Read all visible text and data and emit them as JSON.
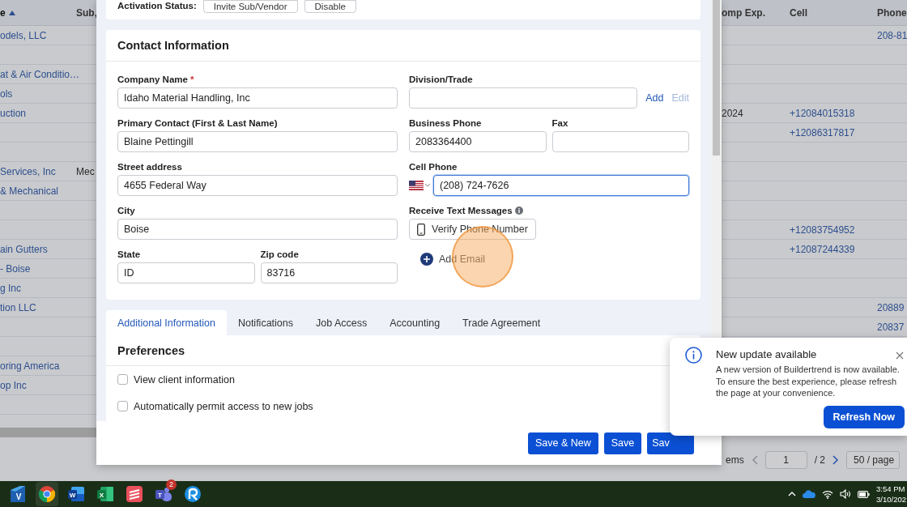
{
  "background_table": {
    "columns": [
      {
        "label": "e",
        "sorted": true
      },
      {
        "label": "Sub,",
        "sorted": false
      },
      {
        "label": "omp Exp.",
        "sorted": false
      },
      {
        "label": "Cell",
        "sorted": false
      },
      {
        "label": "Phone",
        "sorted": false
      }
    ],
    "rows": [
      {
        "name": "odels, LLC",
        "phone": "208-81"
      },
      {},
      {
        "name": "at & Air Conditio…"
      },
      {
        "name": "ols"
      },
      {
        "name": "uction",
        "comp_exp": "2024",
        "cell": "+12084015318"
      },
      {
        "cell": "+12086317817"
      },
      {},
      {
        "name": "Services, Inc",
        "sub": "Mec"
      },
      {
        "name": "& Mechanical"
      },
      {},
      {
        "cell": "+12083754952"
      },
      {
        "name": "ain Gutters",
        "cell": "+12087244339"
      },
      {
        "name": "- Boise"
      },
      {
        "name": "g Inc"
      },
      {
        "name": "tion LLC",
        "phone": "20889"
      },
      {
        "phone": "20837"
      },
      {},
      {
        "name": "oring America"
      },
      {
        "name": "op Inc"
      },
      {}
    ],
    "pagination": {
      "summary": "ems",
      "page": "1",
      "total": "/ 2",
      "page_size": "50 / page"
    }
  },
  "modal": {
    "activation": {
      "label": "Activation Status:",
      "buttons": [
        "Invite Sub/Vendor",
        "Disable"
      ]
    },
    "contact": {
      "title": "Contact Information",
      "rows": [
        {
          "left": [
            {
              "kind": "input",
              "label": "Company Name",
              "required_mark": "*",
              "value": "Idaho Material Handling, Inc"
            }
          ],
          "right": [
            {
              "kind": "input_links",
              "label": "Division/Trade",
              "links": [
                {
                  "label": "Add",
                  "disabled": false
                },
                {
                  "label": "Edit",
                  "disabled": true
                }
              ]
            }
          ]
        },
        {
          "left": [
            {
              "kind": "input",
              "label": "Primary Contact (First & Last Name)",
              "value": "Blaine Pettingill"
            }
          ],
          "right": [
            {
              "kind": "input",
              "label": "Business Phone",
              "value": "2083364400"
            },
            {
              "kind": "input",
              "label": "Fax"
            }
          ]
        },
        {
          "left": [
            {
              "kind": "input",
              "label": "Street address",
              "value": "4655 Federal Way"
            }
          ],
          "right": [
            {
              "kind": "phone",
              "label": "Cell Phone",
              "value": "(208) 724-7626",
              "focused": true
            }
          ]
        },
        {
          "left": [
            {
              "kind": "input",
              "label": "City",
              "value": "Boise"
            }
          ],
          "right": [
            {
              "kind": "verify",
              "label": "Receive Text Messages",
              "button": "Verify Phone Number"
            }
          ]
        },
        {
          "left": [
            {
              "kind": "input",
              "label": "State",
              "value": "ID"
            },
            {
              "kind": "input",
              "label": "Zip code",
              "value": "83716"
            }
          ],
          "right": [
            {
              "kind": "add",
              "text": "Add Email"
            }
          ]
        }
      ]
    },
    "tabs": [
      {
        "label": "Additional Information",
        "selected": true
      },
      {
        "label": "Notifications",
        "selected": false
      },
      {
        "label": "Job Access",
        "selected": false
      },
      {
        "label": "Accounting",
        "selected": false
      },
      {
        "label": "Trade Agreement",
        "selected": false
      }
    ],
    "preferences": {
      "title": "Preferences",
      "options": [
        {
          "label": "View client information",
          "checked": false
        },
        {
          "label": "Automatically permit access to new jobs",
          "checked": false
        }
      ]
    },
    "footer_buttons": [
      "Save & New",
      "Save",
      "Sav"
    ]
  },
  "toast": {
    "title": "New update available",
    "body": "A new version of Buildertrend is now available. To ensure the best experience, please refresh the page at your convenience.",
    "button": "Refresh Now"
  },
  "taskbar": {
    "apps": [
      {
        "kind": "v_tile",
        "glyph": "V",
        "active": false
      },
      {
        "kind": "chrome",
        "active": true
      },
      {
        "kind": "word",
        "glyph": "W",
        "active": false
      },
      {
        "kind": "excel",
        "glyph": "X",
        "active": false
      },
      {
        "kind": "stripes",
        "active": false
      },
      {
        "kind": "teams",
        "glyph": "T",
        "badge": "2",
        "active": false
      },
      {
        "kind": "r_circle",
        "active": false
      }
    ],
    "time": "3:54 PM",
    "date": "3/10/202"
  }
}
